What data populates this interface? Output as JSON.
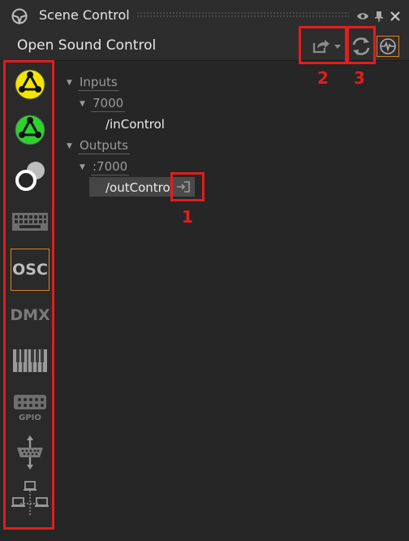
{
  "window": {
    "title": "Scene Control",
    "title_icon": "steering-wheel-icon",
    "buttons": [
      "eye-icon",
      "pin-icon",
      "close-icon"
    ]
  },
  "panel": {
    "title": "Open Sound Control",
    "toolbar": [
      "export-icon",
      "chevron-down-icon",
      "refresh-icon",
      "monitor-icon"
    ]
  },
  "sidebar": {
    "items": [
      {
        "name": "scene-control-yellow",
        "icon": "triangle-network-icon",
        "color": "#f2e500"
      },
      {
        "name": "scene-control-green",
        "icon": "triangle-network-icon",
        "color": "#2fd12f"
      },
      {
        "name": "toggle",
        "icon": "toggle-icon"
      },
      {
        "name": "keyboard",
        "icon": "keyboard-icon"
      },
      {
        "name": "osc",
        "label": "OSC",
        "selected": true
      },
      {
        "name": "dmx",
        "label": "DMX"
      },
      {
        "name": "midi",
        "icon": "piano-icon"
      },
      {
        "name": "gpio",
        "icon": "gpio-icon",
        "label": "GPIO"
      },
      {
        "name": "serial",
        "icon": "serial-port-icon"
      },
      {
        "name": "network",
        "icon": "network-icon"
      }
    ]
  },
  "tree": {
    "inputs": {
      "label": "Inputs",
      "port": "7000",
      "address": "/inControl"
    },
    "outputs": {
      "label": "Outputs",
      "port": ":7000",
      "address": "/outControl"
    }
  },
  "callouts": {
    "one": "1",
    "two": "2",
    "three": "3"
  },
  "colors": {
    "accent": "#d9822b",
    "highlight": "#e11e1e",
    "background": "#262626"
  }
}
